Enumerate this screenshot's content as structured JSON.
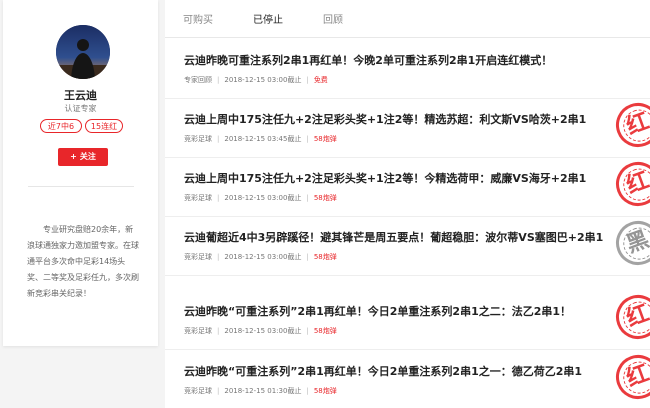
{
  "profile": {
    "name": "王云迪",
    "role": "认证专家",
    "badges": [
      "近7中6",
      "15连红"
    ],
    "follow_label": "关注",
    "follow_plus": "+",
    "bio": "专业研究盘赔20余年，新浪球通独家力邀加盟专家。在球通平台多次命中足彩14场头奖、二等奖及足彩任九，多次刷新竞彩串关纪录！"
  },
  "tabs": [
    "可购买",
    "已停止",
    "回顾"
  ],
  "active_tab": "已停止",
  "articles": [
    {
      "title": "云迪昨晚可重注系列2串1再红单！今晚2单可重注系列2串1开启连红模式！",
      "category": "专家回顾",
      "time": "2018-12-15 03:00截止",
      "price": "免费",
      "stamp": ""
    },
    {
      "title": "云迪上周中175注任九+2注足彩头奖+1注2等！精选苏超：利文斯VS哈茨+2串1",
      "category": "竞彩足球",
      "time": "2018-12-15 03:45截止",
      "price": "58炮弹",
      "stamp": "红"
    },
    {
      "title": "云迪上周中175注任九+2注足彩头奖+1注2等！今精选荷甲：威廉VS海牙+2串1",
      "category": "竞彩足球",
      "time": "2018-12-15 03:00截止",
      "price": "58炮弹",
      "stamp": "红"
    },
    {
      "title": "云迪葡超近4中3另辟蹊径！避其锋芒是周五要点！葡超稳胆：波尔蒂VS塞图巴+2串1",
      "category": "竞彩足球",
      "time": "2018-12-15 03:00截止",
      "price": "58炮弹",
      "stamp": "黑"
    },
    {
      "title": "云迪昨晚“可重注系列”2串1再红单！今日2单重注系列2串1之二：法乙2串1！",
      "category": "竞彩足球",
      "time": "2018-12-15 03:00截止",
      "price": "58炮弹",
      "stamp": "红"
    },
    {
      "title": "云迪昨晚“可重注系列”2串1再红单！今日2单重注系列2串1之一：德乙荷乙2串1",
      "category": "竞彩足球",
      "time": "2018-12-15 01:30截止",
      "price": "58炮弹",
      "stamp": "红"
    }
  ],
  "colors": {
    "accent": "#e8262a",
    "text": "#222222",
    "muted": "#888888"
  }
}
